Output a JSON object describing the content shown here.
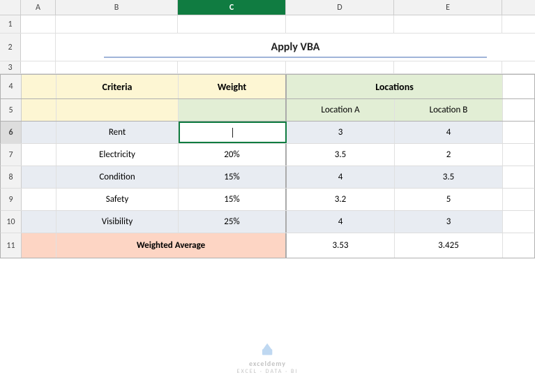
{
  "title": "Apply VBA",
  "columns": {
    "headers": [
      "A",
      "B",
      "C",
      "D",
      "E"
    ],
    "active": "C"
  },
  "rows": {
    "numbers": [
      1,
      2,
      3,
      4,
      5,
      6,
      7,
      8,
      9,
      10,
      11
    ]
  },
  "table": {
    "header_row4": {
      "criteria": "Criteria",
      "weight": "Weight",
      "locations": "Locations"
    },
    "header_row5": {
      "location_a": "Location A",
      "location_b": "Location B"
    },
    "data_rows": [
      {
        "criteria": "Rent",
        "weight": "",
        "loc_a": "3",
        "loc_b": "4"
      },
      {
        "criteria": "Electricity",
        "weight": "20%",
        "loc_a": "3.5",
        "loc_b": "2"
      },
      {
        "criteria": "Condition",
        "weight": "15%",
        "loc_a": "4",
        "loc_b": "3.5"
      },
      {
        "criteria": "Safety",
        "weight": "15%",
        "loc_a": "3.2",
        "loc_b": "5"
      },
      {
        "criteria": "Visibility",
        "weight": "25%",
        "loc_a": "4",
        "loc_b": "3"
      }
    ],
    "footer_row": {
      "label": "Weighted Average",
      "loc_a": "3.53",
      "loc_b": "3.425"
    }
  },
  "watermark": {
    "line1": "exceldemy",
    "line2": "EXCEL · DATA · BI"
  }
}
